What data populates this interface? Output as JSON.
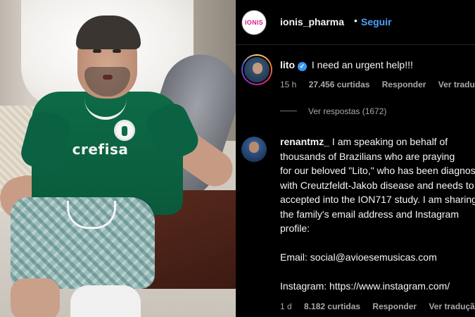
{
  "post": {
    "username": "ionis_pharma",
    "avatar_text": "IONIS",
    "separator": "•",
    "follow_label": "Seguir"
  },
  "comments": [
    {
      "username": "lito",
      "verified": true,
      "text": "I need an urgent help!!!",
      "time": "15 h",
      "likes": "27.456 curtidas",
      "reply_label": "Responder",
      "translate_label": "Ver tradução",
      "view_replies": "Ver respostas (1672)"
    },
    {
      "username": "renantmz_",
      "lines": [
        "I am speaking on behalf of",
        "thousands of Brazilians who are praying",
        "for our beloved \"Lito,\" who has been diagnosed",
        "with Creutzfeldt-Jakob disease and needs to be",
        "accepted into the ION717 study. I am sharing",
        "the family's email address and Instagram",
        "profile:",
        "",
        "Email: social@avioesemusicas.com",
        "",
        "Instagram: https://www.instagram.com/"
      ],
      "time": "1 d",
      "likes": "8.182 curtidas",
      "reply_label": "Responder",
      "translate_label": "Ver tradução"
    }
  ],
  "photo": {
    "jersey_sponsor": "crefisa"
  }
}
